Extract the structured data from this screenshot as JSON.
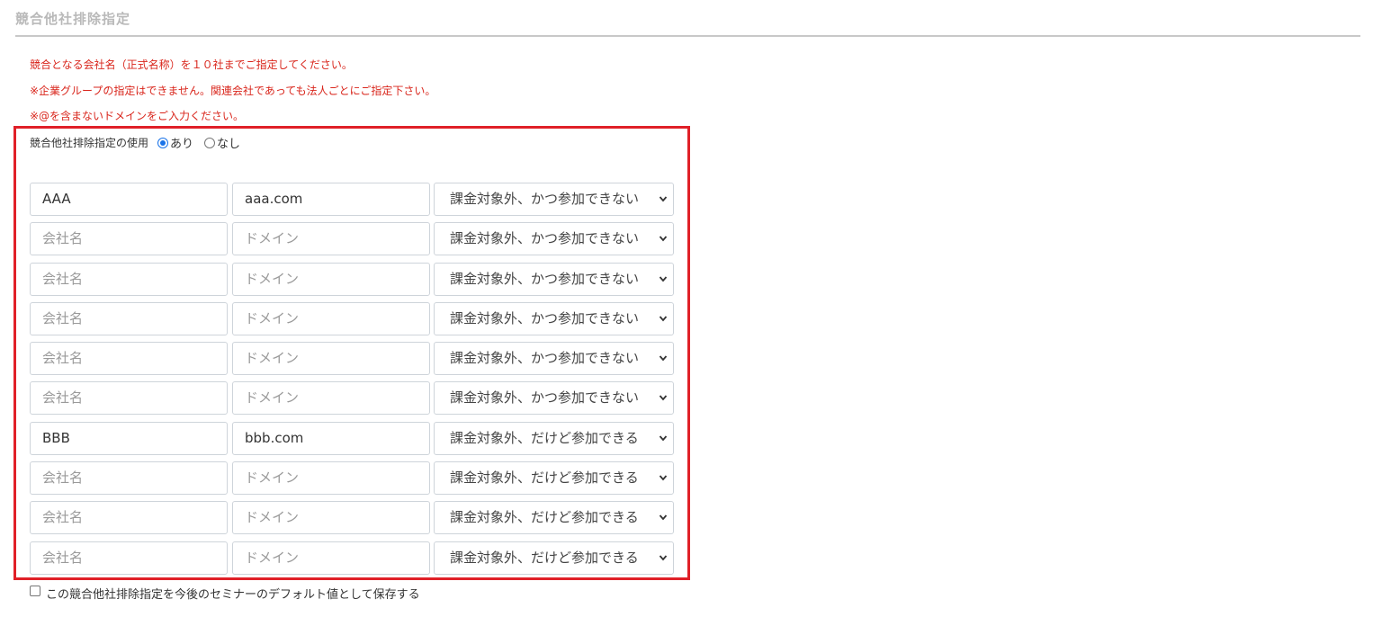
{
  "section": {
    "title": "競合他社排除指定"
  },
  "notices": [
    "競合となる会社名（正式名称）を１０社までご指定してください。",
    "※企業グループの指定はできません。関連会社であっても法人ごとにご指定下さい。",
    "※@を含まないドメインをご入力ください。"
  ],
  "usage": {
    "label": "競合他社排除指定の使用",
    "options": [
      {
        "label": "あり",
        "selected": true
      },
      {
        "label": "なし",
        "selected": false
      }
    ]
  },
  "placeholders": {
    "company": "会社名",
    "domain": "ドメイン"
  },
  "rows": [
    {
      "company": "AAA",
      "domain": "aaa.com",
      "billing": "課金対象外、かつ参加できない"
    },
    {
      "company": "",
      "domain": "",
      "billing": "課金対象外、かつ参加できない"
    },
    {
      "company": "",
      "domain": "",
      "billing": "課金対象外、かつ参加できない"
    },
    {
      "company": "",
      "domain": "",
      "billing": "課金対象外、かつ参加できない"
    },
    {
      "company": "",
      "domain": "",
      "billing": "課金対象外、かつ参加できない"
    },
    {
      "company": "",
      "domain": "",
      "billing": "課金対象外、かつ参加できない"
    },
    {
      "company": "BBB",
      "domain": "bbb.com",
      "billing": "課金対象外、だけど参加できる"
    },
    {
      "company": "",
      "domain": "",
      "billing": "課金対象外、だけど参加できる"
    },
    {
      "company": "",
      "domain": "",
      "billing": "課金対象外、だけど参加できる"
    },
    {
      "company": "",
      "domain": "",
      "billing": "課金対象外、だけど参加できる"
    }
  ],
  "save_default": {
    "label": "この競合他社排除指定を今後のセミナーのデフォルト値として保存する",
    "checked": false
  },
  "colors": {
    "notice": "#d9261c",
    "highlight": "#e02028",
    "title": "#b9b9b9"
  }
}
